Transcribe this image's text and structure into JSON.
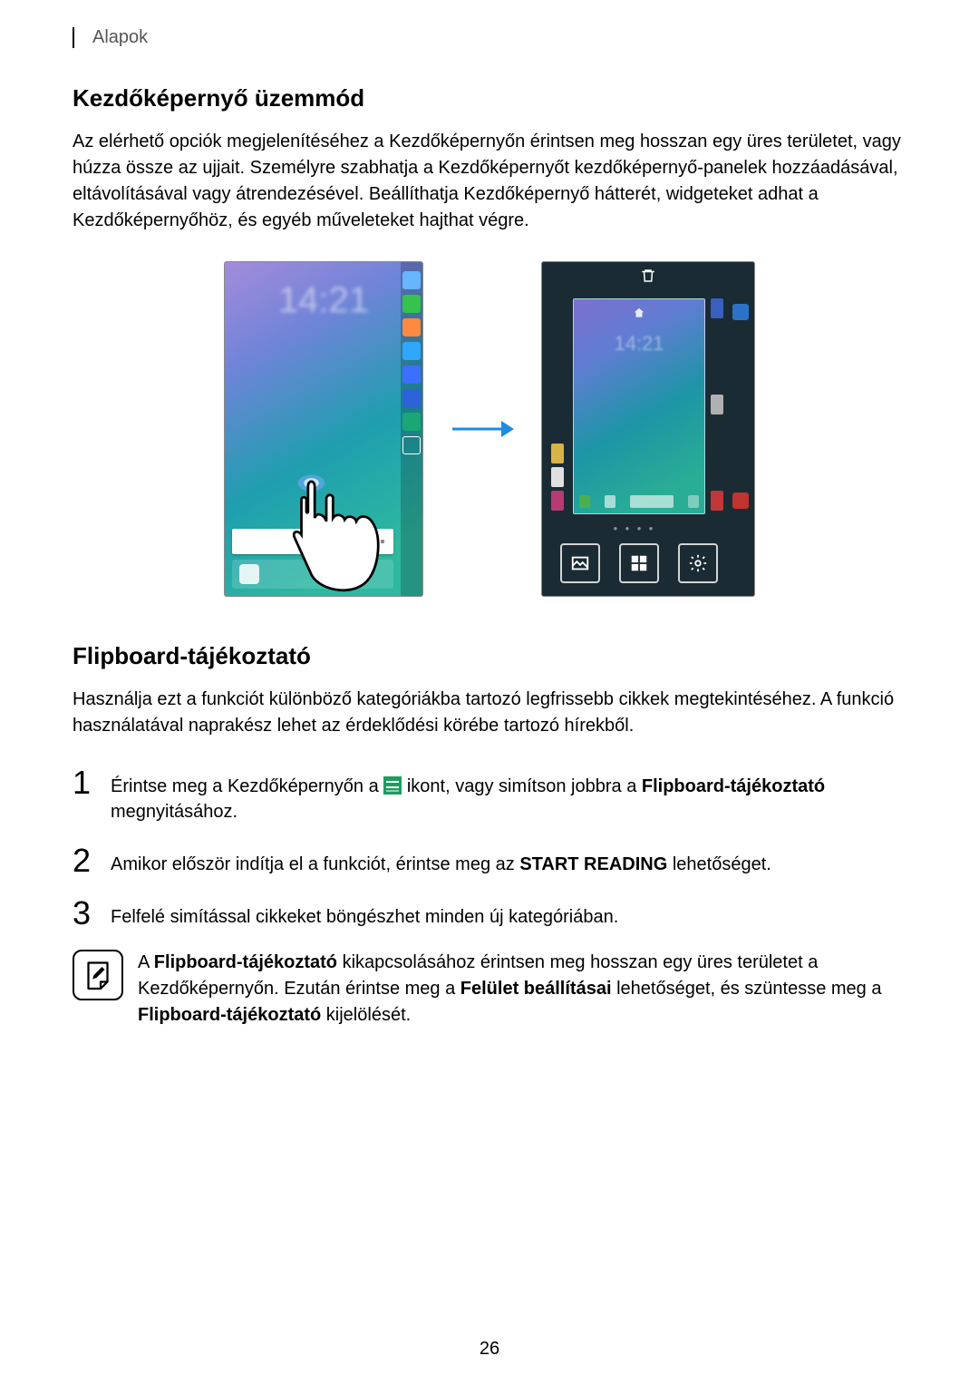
{
  "header": {
    "section": "Alapok"
  },
  "section1": {
    "title": "Kezdőképernyő üzemmód",
    "intro": "Az elérhető opciók megjelenítéséhez a Kezdőképernyőn érintsen meg hosszan egy üres területet, vagy húzza össze az ujjait. Személyre szabhatja a Kezdőképernyőt kezdőképernyő-panelek hozzáadásával, eltávolításával vagy átrendezésével. Beállíthatja Kezdőképernyő hátterét, widgeteket adhat a Kezdőképernyőhöz, és egyéb műveleteket hajthat végre."
  },
  "screenshots": {
    "left": {
      "clock": "14:21"
    },
    "right": {
      "clock": "14:21",
      "trash_icon": "trash-icon",
      "home_icon": "home-icon"
    }
  },
  "section2": {
    "title": "Flipboard-tájékoztató",
    "intro": "Használja ezt a funkciót különböző kategóriákba tartozó legfrissebb cikkek megtekintéséhez. A funkció használatával naprakész lehet az érdeklődési körébe tartozó hírekből."
  },
  "steps": {
    "s1": {
      "num": "1",
      "before": "Érintse meg a Kezdőképernyőn a ",
      "after": " ikont, vagy simítson jobbra a ",
      "bold": "Flipboard-tájékoztató",
      "tail": " megnyitásához."
    },
    "s2": {
      "num": "2",
      "before": "Amikor először indítja el a funkciót, érintse meg az ",
      "bold": "START READING",
      "after": " lehetőséget."
    },
    "s3": {
      "num": "3",
      "text": "Felfelé simítással cikkeket böngészhet minden új kategóriában."
    }
  },
  "note": {
    "p1a": "A ",
    "p1b": "Flipboard-tájékoztató",
    "p1c": " kikapcsolásához érintsen meg hosszan egy üres területet a Kezdőképernyőn. Ezután érintse meg a ",
    "p1d": "Felület beállításai",
    "p1e": " lehetőséget, és szüntesse meg a ",
    "p1f": "Flipboard-tájékoztató",
    "p1g": " kijelölését."
  },
  "page_number": "26"
}
